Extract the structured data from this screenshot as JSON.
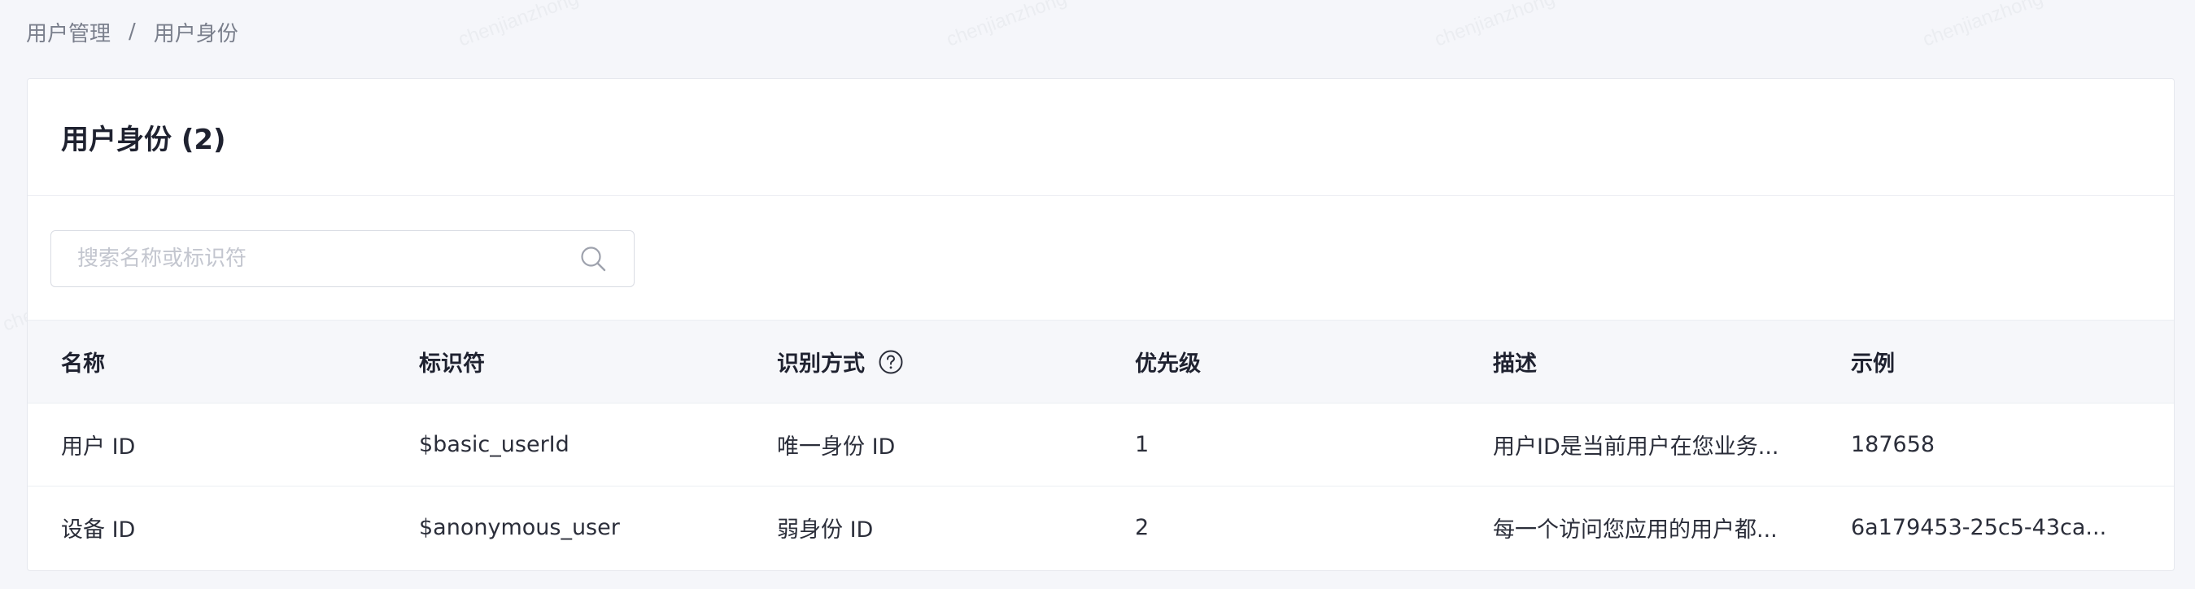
{
  "breadcrumb": {
    "parent": "用户管理",
    "separator": "/",
    "current": "用户身份"
  },
  "watermark": {
    "text": "chenjianzhong"
  },
  "card": {
    "title": "用户身份 (2)"
  },
  "search": {
    "placeholder": "搜索名称或标识符",
    "icon": "search-icon"
  },
  "table": {
    "columns": [
      {
        "label": "名称"
      },
      {
        "label": "标识符"
      },
      {
        "label": "识别方式",
        "icon": "help-icon"
      },
      {
        "label": "优先级"
      },
      {
        "label": "描述"
      },
      {
        "label": "示例"
      }
    ],
    "rows": [
      {
        "name": "用户 ID",
        "identifier": "$basic_userId",
        "method": "唯一身份 ID",
        "priority": "1",
        "description": "用户ID是当前用户在您业务...",
        "example": "187658"
      },
      {
        "name": "设备 ID",
        "identifier": "$anonymous_user",
        "method": "弱身份 ID",
        "priority": "2",
        "description": "每一个访问您应用的用户都...",
        "example": "6a179453-25c5-43ca..."
      }
    ]
  },
  "colors": {
    "background": "#f5f6fa",
    "card": "#ffffff",
    "header_row": "#f6f7fa",
    "border": "#eceef3",
    "text_primary": "#1f2230",
    "text_secondary": "#7a7f8c",
    "placeholder": "#c3c6cf"
  }
}
